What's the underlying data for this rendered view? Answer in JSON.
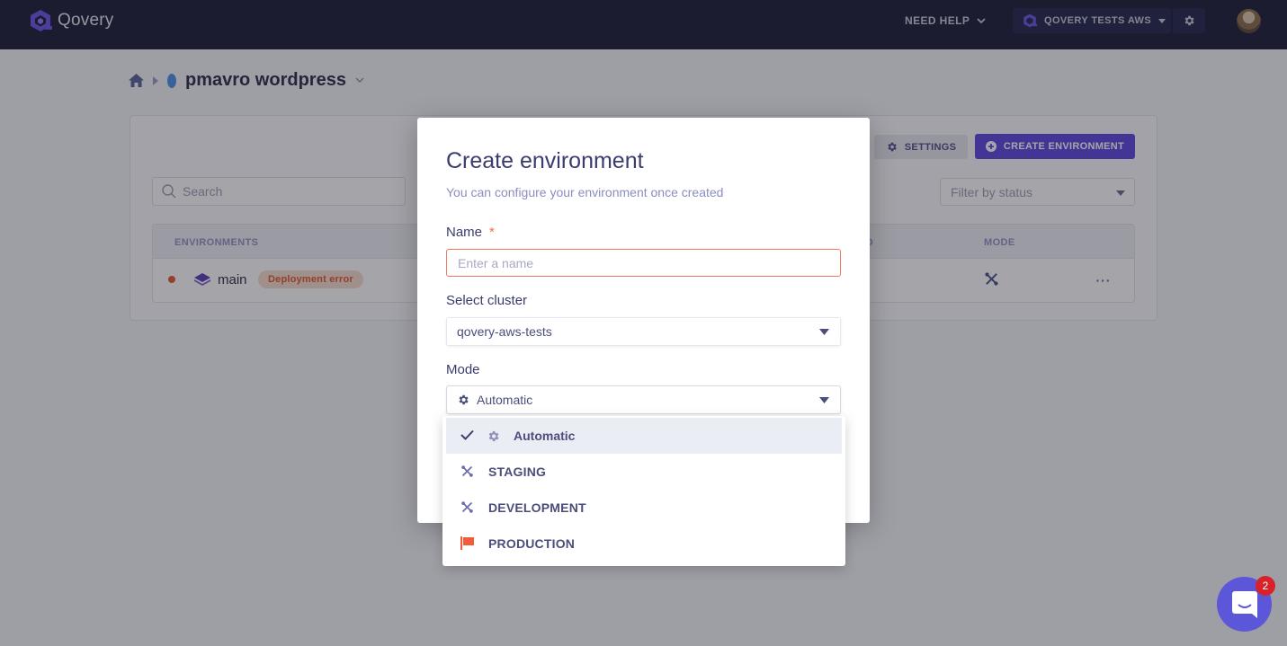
{
  "app": {
    "name": "Qovery"
  },
  "topbar": {
    "need_help": "NEED HELP",
    "organization": "QOVERY TESTS AWS"
  },
  "breadcrumb": {
    "project": "pmavro wordpress"
  },
  "toolbar": {
    "settings_label": "SETTINGS",
    "create_label": "CREATE ENVIRONMENT"
  },
  "search": {
    "placeholder": "Search"
  },
  "filter": {
    "placeholder": "Filter by status"
  },
  "table": {
    "columns": {
      "environments": "ENVIRONMENTS",
      "deployed": "ED",
      "mode": "MODE"
    },
    "rows": [
      {
        "name": "main",
        "status": "Deployment error",
        "deployed": ")",
        "mode": "development",
        "more": "···"
      }
    ]
  },
  "modal": {
    "title": "Create environment",
    "subtitle": "You can configure your environment once created",
    "name_label": "Name",
    "required_mark": "*",
    "name_placeholder": "Enter a name",
    "name_value": "",
    "cluster_label": "Select cluster",
    "cluster_value": "qovery-aws-tests",
    "mode_label": "Mode",
    "mode_value": "Automatic"
  },
  "mode_menu": {
    "items": [
      {
        "label": "Automatic",
        "icon": "gear-icon",
        "selected": true
      },
      {
        "label": "STAGING",
        "icon": "tools-icon",
        "selected": false
      },
      {
        "label": "DEVELOPMENT",
        "icon": "tools-icon",
        "selected": false
      },
      {
        "label": "PRODUCTION",
        "icon": "flag-icon",
        "selected": false
      }
    ]
  },
  "chat": {
    "unread_count": "2"
  },
  "colors": {
    "brand": "#5b45e0",
    "topbar": "#1a1b36",
    "error": "#e8552e",
    "production": "#f25c3b"
  }
}
